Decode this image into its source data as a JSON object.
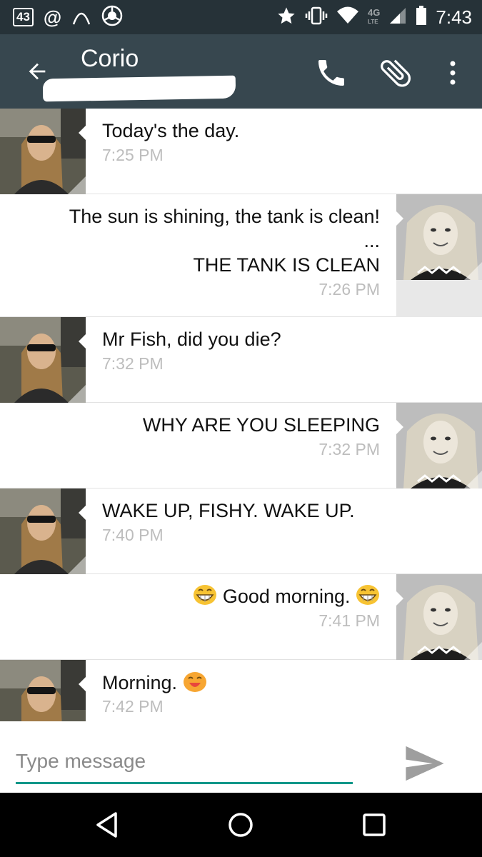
{
  "status_bar": {
    "notification_count": "43",
    "at_symbol": "@",
    "network_label": "4G",
    "lte_label": "LTE",
    "time": "7:43"
  },
  "header": {
    "contact_name": "Corio",
    "icons": [
      "back-arrow-icon",
      "phone-icon",
      "paperclip-icon",
      "more-vert-icon"
    ]
  },
  "messages": [
    {
      "direction": "in",
      "lines": [
        "Today's the day."
      ],
      "time": "7:25 PM"
    },
    {
      "direction": "out",
      "lines": [
        "The sun is shining, the tank is clean!",
        "...",
        "THE TANK IS CLEAN"
      ],
      "time": "7:26 PM"
    },
    {
      "direction": "in",
      "lines": [
        "Mr Fish, did you die?"
      ],
      "time": "7:32 PM"
    },
    {
      "direction": "out",
      "lines": [
        "WHY ARE YOU SLEEPING"
      ],
      "time": "7:32 PM"
    },
    {
      "direction": "in",
      "lines": [
        "WAKE UP, FISHY. WAKE UP."
      ],
      "time": "7:40 PM"
    },
    {
      "direction": "out",
      "text": "Good morning.",
      "emoji": "grinning-face-emoji",
      "time": "7:41 PM"
    },
    {
      "direction": "in",
      "text": "Morning.",
      "emoji": "smiling-face-emoji",
      "time": "7:42 PM"
    }
  ],
  "compose": {
    "placeholder": "Type message"
  },
  "colors": {
    "status_bar": "#263238",
    "app_bar": "#37474f",
    "accent": "#009688",
    "timestamp": "#bdbdbd"
  }
}
